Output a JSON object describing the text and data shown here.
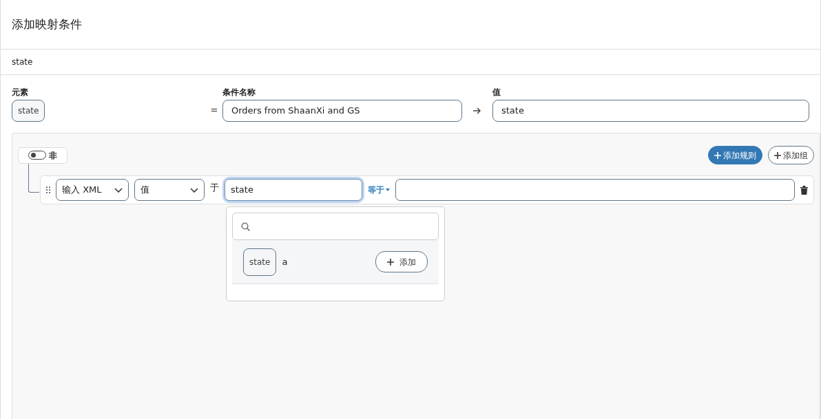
{
  "header": {
    "title": "添加映射条件"
  },
  "breadcrumb": "state",
  "mapping": {
    "element_label": "元素",
    "element_tag": "state",
    "equals": "=",
    "name_label": "条件名称",
    "name_value": "Orders from ShaanXi and GS",
    "value_label": "值",
    "value_value": "state"
  },
  "query_builder": {
    "not_toggle": {
      "label": "非",
      "on": false
    },
    "add_rule": "添加规则",
    "add_group": "添加组",
    "rules": [
      {
        "source": "输入 XML",
        "field": "值",
        "preposition": "于",
        "input": "state",
        "focused": true,
        "operator": "等于",
        "suggestions": [
          {
            "tag": "state",
            "text": "a",
            "button": "添加"
          }
        ]
      }
    ]
  }
}
